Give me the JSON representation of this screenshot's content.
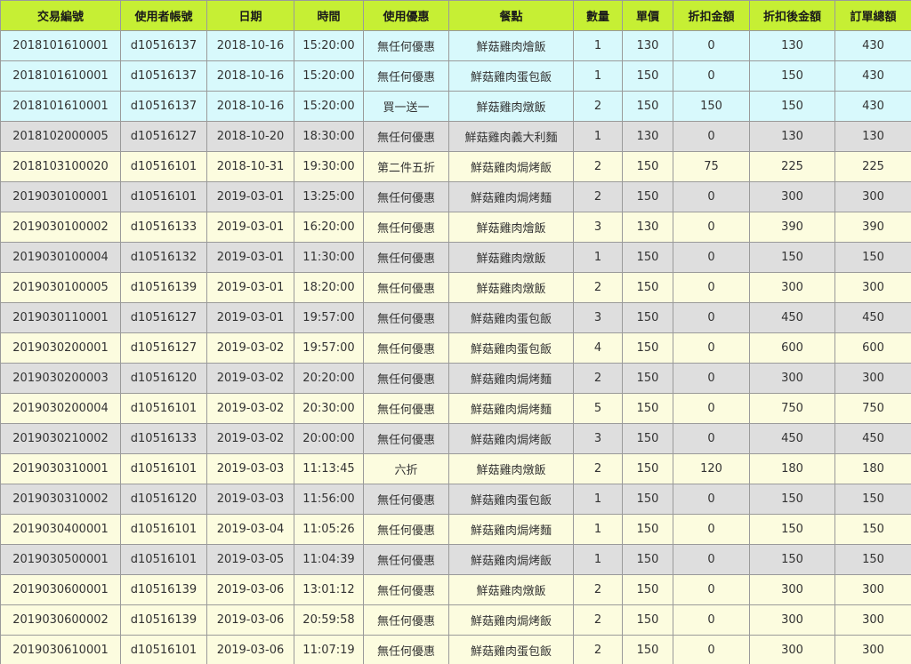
{
  "colors": {
    "header": "#c6ef34",
    "row_cyan": "#d8f9fc",
    "row_gray": "#dedede",
    "row_cream": "#fcfcdf",
    "border": "#9a9a9a"
  },
  "table": {
    "headers": [
      "交易編號",
      "使用者帳號",
      "日期",
      "時間",
      "使用優惠",
      "餐點",
      "數量",
      "單價",
      "折扣金額",
      "折扣後金額",
      "訂單總額"
    ],
    "rows": [
      {
        "style": "cyan",
        "cells": [
          "2018101610001",
          "d10516137",
          "2018-10-16",
          "15:20:00",
          "無任何優惠",
          "鮮菇雞肉燴飯",
          "1",
          "130",
          "0",
          "130",
          "430"
        ]
      },
      {
        "style": "cyan",
        "cells": [
          "2018101610001",
          "d10516137",
          "2018-10-16",
          "15:20:00",
          "無任何優惠",
          "鮮菇雞肉蛋包飯",
          "1",
          "150",
          "0",
          "150",
          "430"
        ]
      },
      {
        "style": "cyan",
        "cells": [
          "2018101610001",
          "d10516137",
          "2018-10-16",
          "15:20:00",
          "買一送一",
          "鮮菇雞肉燉飯",
          "2",
          "150",
          "150",
          "150",
          "430"
        ]
      },
      {
        "style": "gray",
        "cells": [
          "2018102000005",
          "d10516127",
          "2018-10-20",
          "18:30:00",
          "無任何優惠",
          "鮮菇雞肉義大利麵",
          "1",
          "130",
          "0",
          "130",
          "130"
        ]
      },
      {
        "style": "cream",
        "cells": [
          "2018103100020",
          "d10516101",
          "2018-10-31",
          "19:30:00",
          "第二件五折",
          "鮮菇雞肉焗烤飯",
          "2",
          "150",
          "75",
          "225",
          "225"
        ]
      },
      {
        "style": "gray",
        "cells": [
          "2019030100001",
          "d10516101",
          "2019-03-01",
          "13:25:00",
          "無任何優惠",
          "鮮菇雞肉焗烤麵",
          "2",
          "150",
          "0",
          "300",
          "300"
        ]
      },
      {
        "style": "cream",
        "cells": [
          "2019030100002",
          "d10516133",
          "2019-03-01",
          "16:20:00",
          "無任何優惠",
          "鮮菇雞肉燴飯",
          "3",
          "130",
          "0",
          "390",
          "390"
        ]
      },
      {
        "style": "gray",
        "cells": [
          "2019030100004",
          "d10516132",
          "2019-03-01",
          "11:30:00",
          "無任何優惠",
          "鮮菇雞肉燉飯",
          "1",
          "150",
          "0",
          "150",
          "150"
        ]
      },
      {
        "style": "cream",
        "cells": [
          "2019030100005",
          "d10516139",
          "2019-03-01",
          "18:20:00",
          "無任何優惠",
          "鮮菇雞肉燉飯",
          "2",
          "150",
          "0",
          "300",
          "300"
        ]
      },
      {
        "style": "gray",
        "cells": [
          "2019030110001",
          "d10516127",
          "2019-03-01",
          "19:57:00",
          "無任何優惠",
          "鮮菇雞肉蛋包飯",
          "3",
          "150",
          "0",
          "450",
          "450"
        ]
      },
      {
        "style": "cream",
        "cells": [
          "2019030200001",
          "d10516127",
          "2019-03-02",
          "19:57:00",
          "無任何優惠",
          "鮮菇雞肉蛋包飯",
          "4",
          "150",
          "0",
          "600",
          "600"
        ]
      },
      {
        "style": "gray",
        "cells": [
          "2019030200003",
          "d10516120",
          "2019-03-02",
          "20:20:00",
          "無任何優惠",
          "鮮菇雞肉焗烤麵",
          "2",
          "150",
          "0",
          "300",
          "300"
        ]
      },
      {
        "style": "cream",
        "cells": [
          "2019030200004",
          "d10516101",
          "2019-03-02",
          "20:30:00",
          "無任何優惠",
          "鮮菇雞肉焗烤麵",
          "5",
          "150",
          "0",
          "750",
          "750"
        ]
      },
      {
        "style": "gray",
        "cells": [
          "2019030210002",
          "d10516133",
          "2019-03-02",
          "20:00:00",
          "無任何優惠",
          "鮮菇雞肉焗烤飯",
          "3",
          "150",
          "0",
          "450",
          "450"
        ]
      },
      {
        "style": "cream",
        "cells": [
          "2019030310001",
          "d10516101",
          "2019-03-03",
          "11:13:45",
          "六折",
          "鮮菇雞肉燉飯",
          "2",
          "150",
          "120",
          "180",
          "180"
        ]
      },
      {
        "style": "gray",
        "cells": [
          "2019030310002",
          "d10516120",
          "2019-03-03",
          "11:56:00",
          "無任何優惠",
          "鮮菇雞肉蛋包飯",
          "1",
          "150",
          "0",
          "150",
          "150"
        ]
      },
      {
        "style": "cream",
        "cells": [
          "2019030400001",
          "d10516101",
          "2019-03-04",
          "11:05:26",
          "無任何優惠",
          "鮮菇雞肉焗烤麵",
          "1",
          "150",
          "0",
          "150",
          "150"
        ]
      },
      {
        "style": "gray",
        "cells": [
          "2019030500001",
          "d10516101",
          "2019-03-05",
          "11:04:39",
          "無任何優惠",
          "鮮菇雞肉焗烤飯",
          "1",
          "150",
          "0",
          "150",
          "150"
        ]
      },
      {
        "style": "cream",
        "cells": [
          "2019030600001",
          "d10516139",
          "2019-03-06",
          "13:01:12",
          "無任何優惠",
          "鮮菇雞肉燉飯",
          "2",
          "150",
          "0",
          "300",
          "300"
        ]
      },
      {
        "style": "cream",
        "cells": [
          "2019030600002",
          "d10516139",
          "2019-03-06",
          "20:59:58",
          "無任何優惠",
          "鮮菇雞肉焗烤飯",
          "2",
          "150",
          "0",
          "300",
          "300"
        ]
      },
      {
        "style": "cream",
        "cells": [
          "2019030610001",
          "d10516101",
          "2019-03-06",
          "11:07:19",
          "無任何優惠",
          "鮮菇雞肉蛋包飯",
          "2",
          "150",
          "0",
          "300",
          "300"
        ]
      }
    ]
  }
}
